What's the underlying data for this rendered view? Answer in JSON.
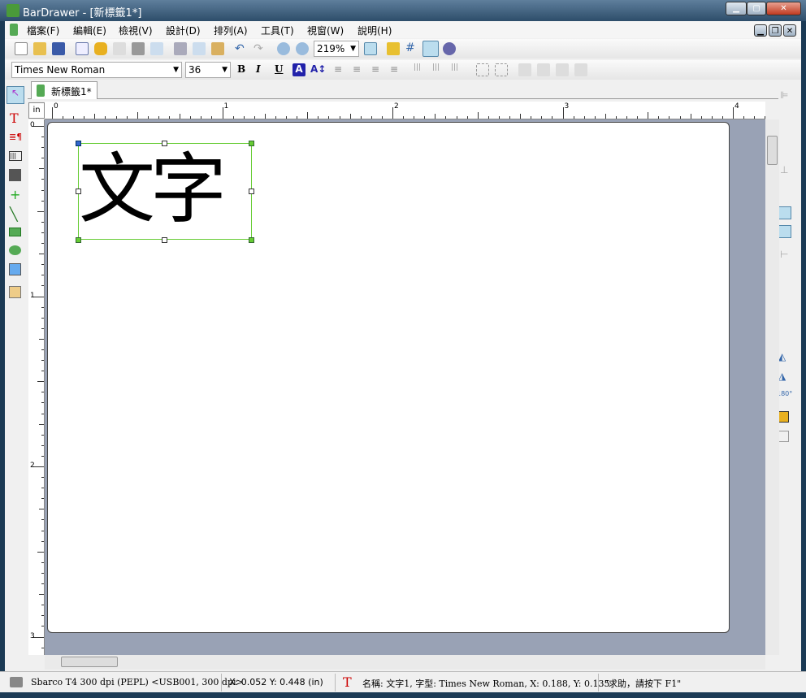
{
  "window": {
    "title": "BarDrawer - [新標籤1*]",
    "min": "▁",
    "max": "▢",
    "close": "✕"
  },
  "menu": [
    "檔案(F)",
    "編輯(E)",
    "檢視(V)",
    "設計(D)",
    "排列(A)",
    "工具(T)",
    "視窗(W)",
    "說明(H)"
  ],
  "mdi": {
    "min": "▁",
    "restore": "❐",
    "close": "✕"
  },
  "toolbar": {
    "zoom": "219%"
  },
  "format": {
    "font": "Times New Roman",
    "size": "36",
    "bold": "B",
    "italic": "I",
    "underline": "U",
    "color": "A"
  },
  "tab": {
    "label": "新標籤1*"
  },
  "ruler": {
    "unit": "in",
    "h_labels": [
      "0",
      "1",
      "2",
      "3",
      "4"
    ],
    "v_labels": [
      "0",
      "1",
      "2",
      "3"
    ]
  },
  "canvas": {
    "text": "文字"
  },
  "status": {
    "printer": "Sbarco T4 300 dpi (PEPL) <USB001, 300 dpi>",
    "coords": "X: 0.052  Y: 0.448 (in)",
    "object": "名稱: 文字1, 字型: Times New Roman, X: 0.188, Y: 0.135",
    "help": "\"求助，請按下 F1\""
  },
  "colors": {
    "selection": "#6c3",
    "canvas_bg": "#99a2b5",
    "text_icon": "#c00"
  }
}
